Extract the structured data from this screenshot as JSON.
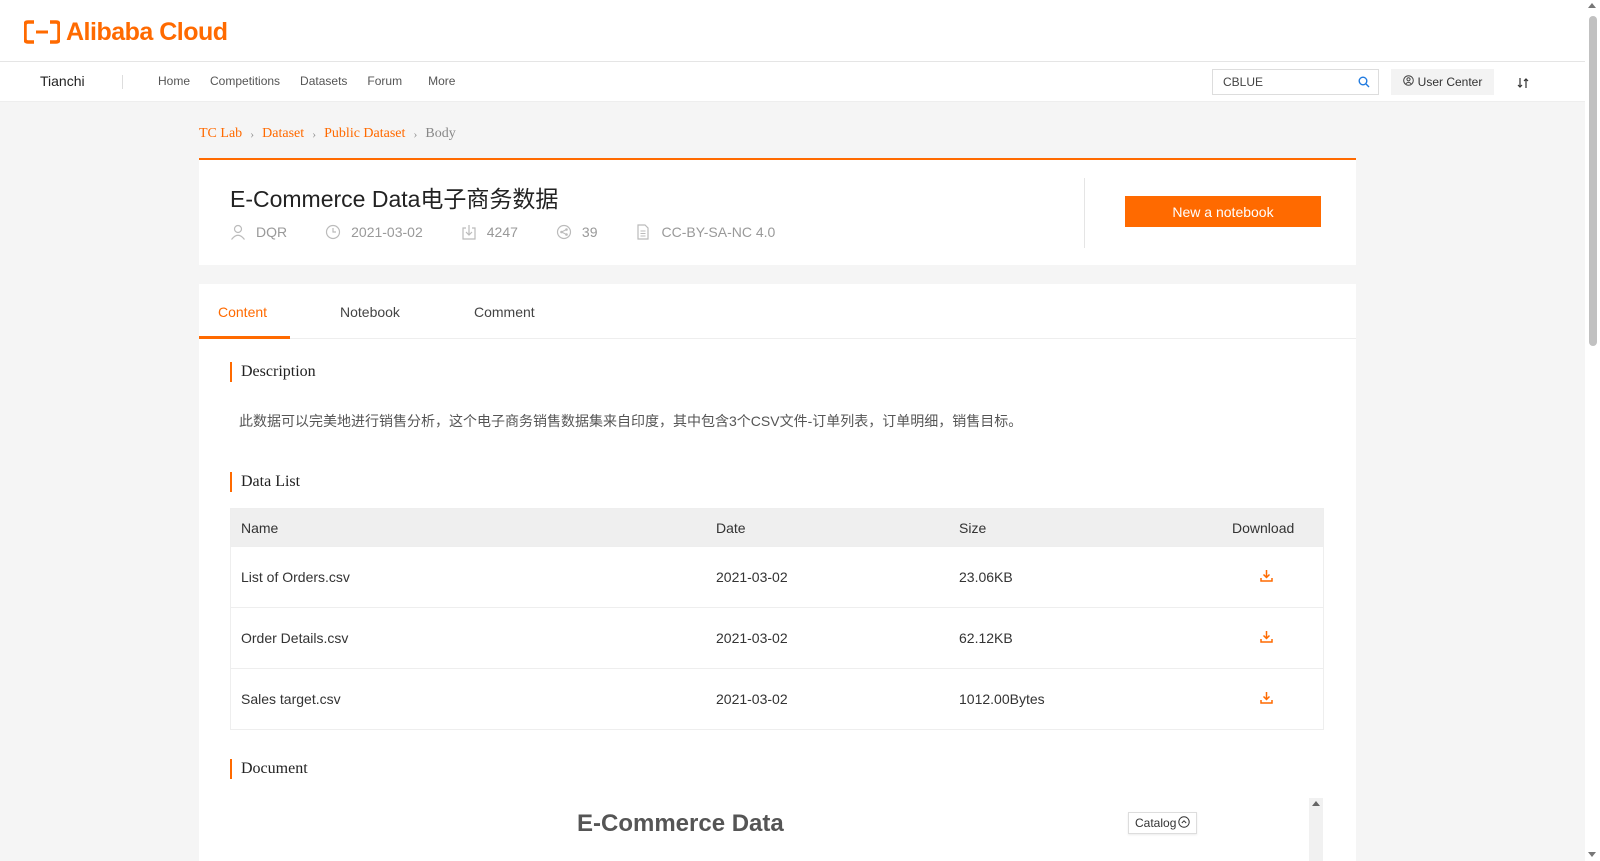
{
  "header": {
    "logo_text": "Alibaba Cloud",
    "brand_color": "#ff6a00"
  },
  "nav": {
    "brand": "Tianchi",
    "links": [
      "Home",
      "Competitions",
      "Datasets",
      "Forum"
    ],
    "more": "More",
    "search_value": "CBLUE",
    "user_center": "User Center"
  },
  "breadcrumb": [
    "TC Lab",
    "Dataset",
    "Public Dataset",
    "Body"
  ],
  "dataset": {
    "title": "E-Commerce Data电子商务数据",
    "author": "DQR",
    "date": "2021-03-02",
    "downloads": "4247",
    "shares": "39",
    "license": "CC-BY-SA-NC 4.0",
    "new_notebook_label": "New a notebook"
  },
  "tabs": [
    "Content",
    "Notebook",
    "Comment"
  ],
  "sections": {
    "description_title": "Description",
    "description_text": "此数据可以完美地进行销售分析，这个电子商务销售数据集来自印度，其中包含3个CSV文件-订单列表，订单明细，销售目标。",
    "data_list_title": "Data List",
    "document_title": "Document"
  },
  "table": {
    "headers": [
      "Name",
      "Date",
      "Size",
      "Download"
    ],
    "rows": [
      {
        "name": "List of Orders.csv",
        "date": "2021-03-02",
        "size": "23.06KB"
      },
      {
        "name": "Order Details.csv",
        "date": "2021-03-02",
        "size": "62.12KB"
      },
      {
        "name": "Sales target.csv",
        "date": "2021-03-02",
        "size": "1012.00Bytes"
      }
    ]
  },
  "document": {
    "heading": "E-Commerce Data",
    "catalog_label": "Catalog"
  },
  "icons": {
    "search": "search-icon",
    "user": "user-icon",
    "clock": "clock-icon",
    "download": "download-icon",
    "share": "share-icon",
    "license": "document-icon",
    "swap": "swap-icon"
  }
}
